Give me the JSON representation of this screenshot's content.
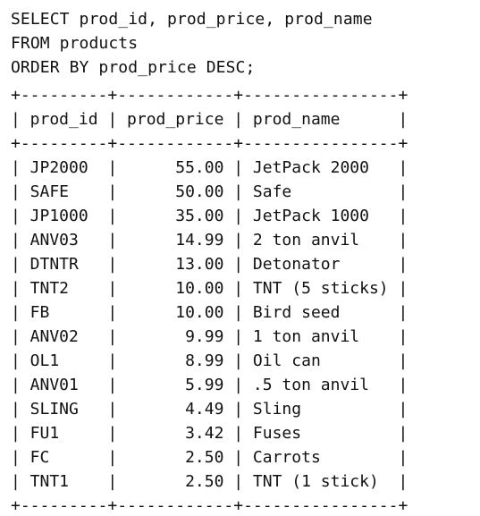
{
  "query": [
    "SELECT prod_id, prod_price, prod_name",
    "FROM products",
    "ORDER BY prod_price DESC;"
  ],
  "results": {
    "columns": [
      "prod_id",
      "prod_price",
      "prod_name"
    ],
    "rows": [
      {
        "prod_id": "JP2000",
        "prod_price": "55.00",
        "prod_name": "JetPack 2000"
      },
      {
        "prod_id": "SAFE",
        "prod_price": "50.00",
        "prod_name": "Safe"
      },
      {
        "prod_id": "JP1000",
        "prod_price": "35.00",
        "prod_name": "JetPack 1000"
      },
      {
        "prod_id": "ANV03",
        "prod_price": "14.99",
        "prod_name": "2 ton anvil"
      },
      {
        "prod_id": "DTNTR",
        "prod_price": "13.00",
        "prod_name": "Detonator"
      },
      {
        "prod_id": "TNT2",
        "prod_price": "10.00",
        "prod_name": "TNT (5 sticks)"
      },
      {
        "prod_id": "FB",
        "prod_price": "10.00",
        "prod_name": "Bird seed"
      },
      {
        "prod_id": "ANV02",
        "prod_price": "9.99",
        "prod_name": "1 ton anvil"
      },
      {
        "prod_id": "OL1",
        "prod_price": "8.99",
        "prod_name": "Oil can"
      },
      {
        "prod_id": "ANV01",
        "prod_price": "5.99",
        "prod_name": ".5 ton anvil"
      },
      {
        "prod_id": "SLING",
        "prod_price": "4.49",
        "prod_name": "Sling"
      },
      {
        "prod_id": "FU1",
        "prod_price": "3.42",
        "prod_name": "Fuses"
      },
      {
        "prod_id": "FC",
        "prod_price": "2.50",
        "prod_name": "Carrots"
      },
      {
        "prod_id": "TNT1",
        "prod_price": "2.50",
        "prod_name": "TNT (1 stick)"
      }
    ]
  }
}
